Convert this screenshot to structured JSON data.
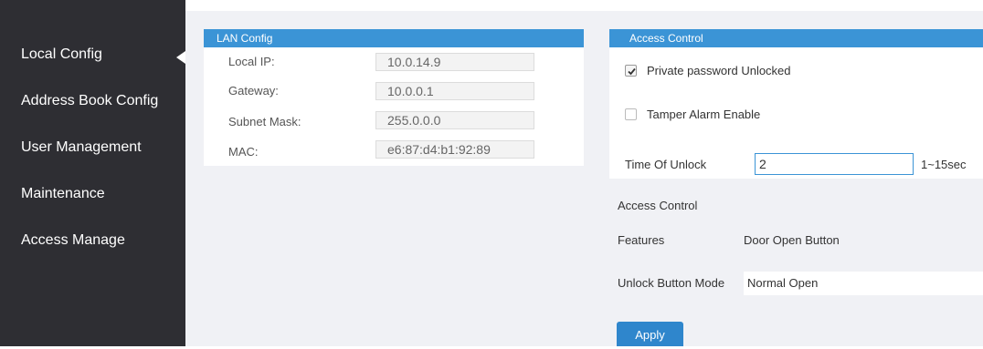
{
  "sidebar": {
    "items": [
      {
        "label": "Local Config"
      },
      {
        "label": "Address Book Config"
      },
      {
        "label": "User Management"
      },
      {
        "label": "Maintenance"
      },
      {
        "label": "Access Manage"
      }
    ],
    "active_index": 0
  },
  "lan": {
    "title": "LAN Config",
    "local_ip_label": "Local IP:",
    "local_ip": "10.0.14.9",
    "gateway_label": "Gateway:",
    "gateway": "10.0.0.1",
    "subnet_label": "Subnet Mask:",
    "subnet": "255.0.0.0",
    "mac_label": "MAC:",
    "mac": "e6:87:d4:b1:92:89"
  },
  "access": {
    "title": "Access Control",
    "private_password_label": "Private password Unlocked",
    "private_password_checked": true,
    "tamper_label": "Tamper Alarm Enable",
    "tamper_checked": false,
    "time_label": "Time Of Unlock",
    "time_value": "2",
    "time_range": "1~15sec",
    "section_label": "Access Control",
    "features_label": "Features",
    "features_value": "Door Open Button",
    "mode_label": "Unlock Button Mode",
    "mode_value": "Normal Open",
    "apply_label": "Apply"
  },
  "colors": {
    "sidebar_bg": "#2e2e33",
    "header_blue": "#3b94d6",
    "button_blue": "#2f86cc",
    "content_bg": "#f0f1f5"
  }
}
